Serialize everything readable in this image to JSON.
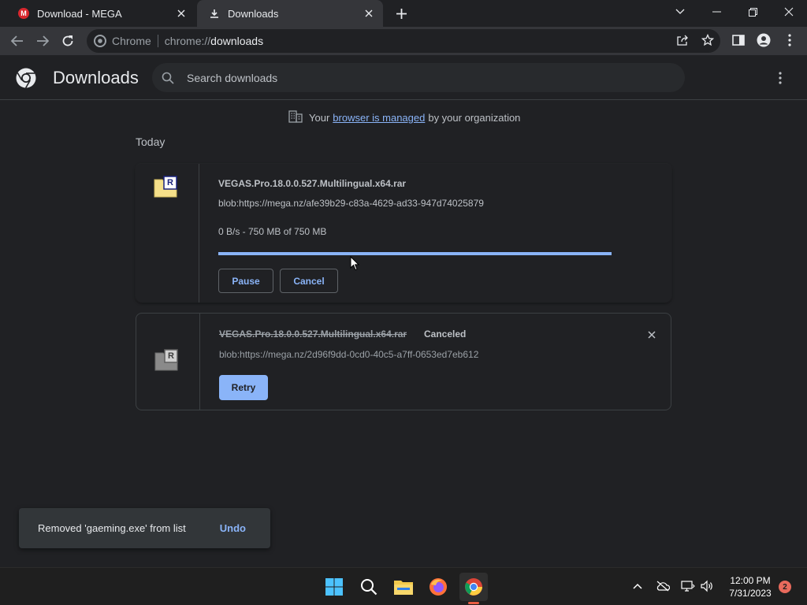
{
  "tabs": [
    {
      "label": "Download - MEGA",
      "favicon": "mega-icon",
      "logo_letter": "M"
    },
    {
      "label": "Downloads",
      "favicon": "download-icon"
    }
  ],
  "omnibox": {
    "chip": "Chrome",
    "scheme": "chrome://",
    "host": "downloads"
  },
  "page": {
    "title": "Downloads",
    "search_placeholder": "Search downloads"
  },
  "managed_notice": {
    "before": "Your",
    "link": "browser is managed",
    "after": "by your organization"
  },
  "section_label": "Today",
  "downloads": [
    {
      "filename": "VEGAS.Pro.18.0.0.527.Multilingual.x64.rar",
      "url": "blob:https://mega.nz/afe39b29-c83a-4629-ad33-947d74025879",
      "progress_text": "0 B/s - 750 MB of 750 MB",
      "progress": 1.0,
      "pause_label": "Pause",
      "cancel_label": "Cancel",
      "file_icon": "rar-archive-icon",
      "icon_letter": "R"
    },
    {
      "filename": "VEGAS.Pro.18.0.0.527.Multilingual.x64.rar",
      "status": "Canceled",
      "url": "blob:https://mega.nz/2d96f9dd-0cd0-40c5-a7ff-0653ed7eb612",
      "retry_label": "Retry",
      "file_icon": "rar-archive-icon",
      "icon_letter": "R"
    }
  ],
  "toast": {
    "message": "Removed 'gaeming.exe' from list",
    "undo_label": "Undo"
  },
  "taskbar": {
    "time": "12:00 PM",
    "date": "7/31/2023",
    "notification_count": "2"
  },
  "colors": {
    "accent": "#8ab4f8",
    "background": "#202124",
    "toolbar": "#35363a"
  }
}
